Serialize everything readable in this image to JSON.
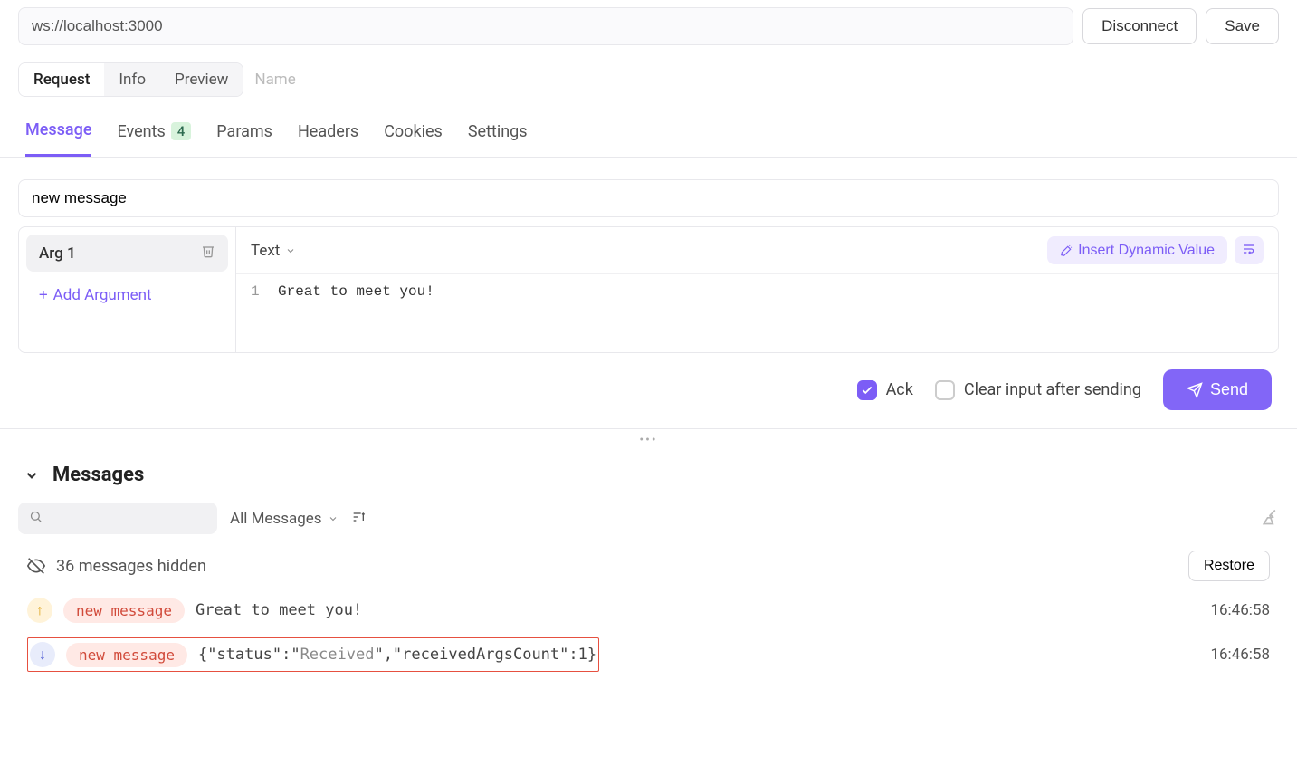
{
  "header": {
    "url": "ws://localhost:3000",
    "disconnect": "Disconnect",
    "save": "Save"
  },
  "topTabs": {
    "request": "Request",
    "info": "Info",
    "preview": "Preview",
    "namePlaceholder": "Name"
  },
  "subTabs": {
    "message": "Message",
    "events": "Events",
    "eventsCount": "4",
    "params": "Params",
    "headers": "Headers",
    "cookies": "Cookies",
    "settings": "Settings"
  },
  "composer": {
    "eventName": "new message",
    "arg1Label": "Arg 1",
    "addArgument": "Add Argument",
    "bodyTypeLabel": "Text",
    "insertDynamic": "Insert Dynamic Value",
    "lineNum": "1",
    "bodyContent": "Great to meet you!"
  },
  "sendRow": {
    "ack": "Ack",
    "clearInput": "Clear input after sending",
    "send": "Send"
  },
  "messagesSection": {
    "title": "Messages",
    "filterLabel": "All Messages",
    "hiddenCount": "36 messages hidden",
    "restore": "Restore"
  },
  "messages": [
    {
      "direction": "up",
      "event": "new message",
      "body": "Great to meet you!",
      "time": "16:46:58"
    },
    {
      "direction": "down",
      "event": "new message",
      "body_pre": "{\"status\":\"",
      "body_mid": "Received",
      "body_post": "\",\"receivedArgsCount\":1}",
      "time": "16:46:58"
    }
  ]
}
